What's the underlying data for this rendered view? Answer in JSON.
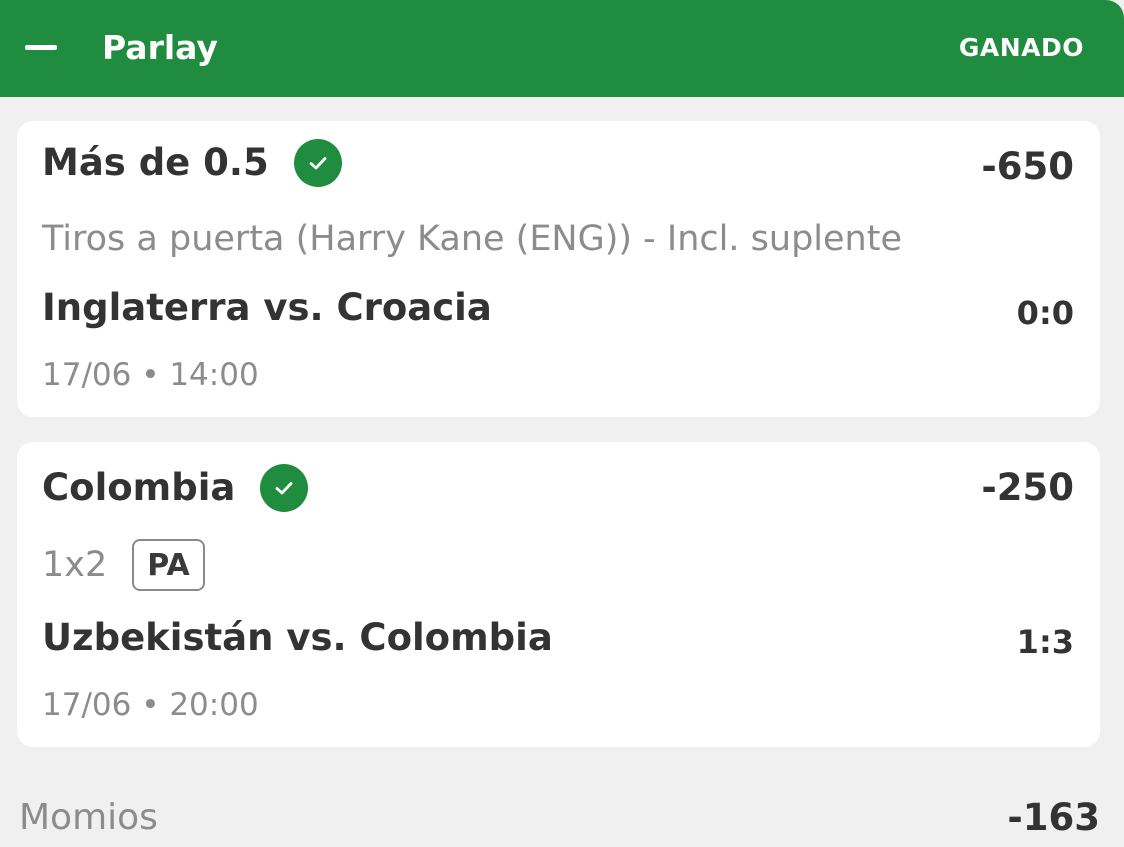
{
  "header": {
    "title": "Parlay",
    "status": "GANADO",
    "collapse_icon": "minus-icon",
    "color": "#1f8c3f"
  },
  "selections": [
    {
      "name": "Más de 0.5",
      "status_icon": "check-circle-icon",
      "odds": "-650",
      "market": "Tiros a puerta (Harry Kane (ENG)) - Incl. suplente",
      "match": "Inglaterra vs. Croacia",
      "score": "0:0",
      "datetime": "17/06 • 14:00"
    },
    {
      "name": "Colombia",
      "status_icon": "check-circle-icon",
      "odds": "-250",
      "market": "1x2",
      "badge": "PA",
      "match": "Uzbekistán vs. Colombia",
      "score": "1:3",
      "datetime": "17/06 • 20:00"
    }
  ],
  "footer": {
    "label": "Momios",
    "odds": "-163"
  }
}
